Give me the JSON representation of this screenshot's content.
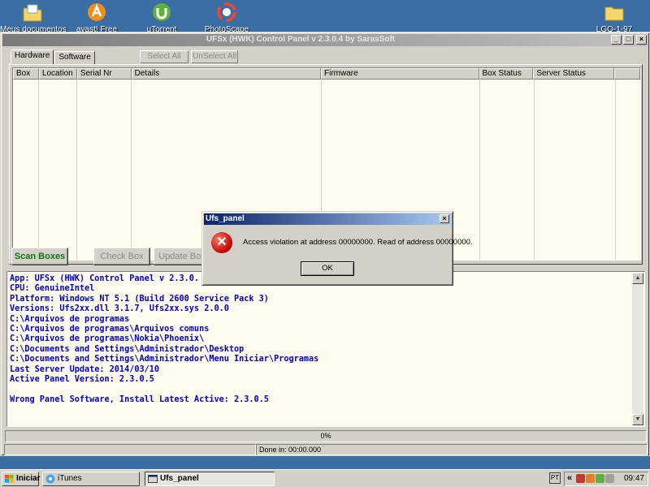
{
  "desktop": {
    "icons": [
      {
        "label": "Meus documentos",
        "icon": "folder-documents-icon"
      },
      {
        "label": "avast! Free",
        "icon": "avast-icon"
      },
      {
        "label": "uTorrent",
        "icon": "utorrent-icon"
      },
      {
        "label": "PhotoScape",
        "icon": "photoscape-icon"
      },
      {
        "label": "LGO-1-97",
        "icon": "folder-icon"
      }
    ]
  },
  "window": {
    "title": "UFSx (HWK) Control Panel v 2.3.0.4 by SarasSoft",
    "tabs": [
      "Hardware",
      "Software"
    ],
    "select_all": "Select All",
    "unselect_all": "UnSelect All",
    "columns": [
      "Box",
      "Location",
      "Serial Nr",
      "Details",
      "Firmware",
      "Box Status",
      "Server Status"
    ],
    "buttons": {
      "scan": "Scan Boxes",
      "check": "Check Box",
      "update": "Update Box"
    },
    "log_lines": [
      "App: UFSx (HWK) Control Panel v 2.3.0.",
      "CPU: GenuineIntel",
      "Platform: Windows NT 5.1 (Build 2600 Service Pack 3)",
      "Versions: Ufs2xx.dll 3.1.7, Ufs2xx.sys 2.0.0",
      "C:\\Arquivos de programas",
      "C:\\Arquivos de programas\\Arquivos comuns",
      "C:\\Arquivos de programas\\Nokia\\Phoenix\\",
      "C:\\Documents and Settings\\Administrador\\Desktop",
      "C:\\Documents and Settings\\Administrador\\Menu Iniciar\\Programas",
      "Last Server Update: 2014/03/10",
      "Active Panel Version: 2.3.0.5",
      "",
      "Wrong Panel Software, Install Latest Active: 2.3.0.5"
    ],
    "progress": "0%",
    "status_done": "Done in: 00:00.000"
  },
  "dialog": {
    "title": "Ufs_panel",
    "message": "Access violation at address 00000000. Read of address 00000000.",
    "ok": "OK"
  },
  "taskbar": {
    "start": "Iniciar",
    "tasks": [
      "iTunes",
      "Ufs_panel"
    ],
    "lang": "PT",
    "time": "09:47"
  }
}
